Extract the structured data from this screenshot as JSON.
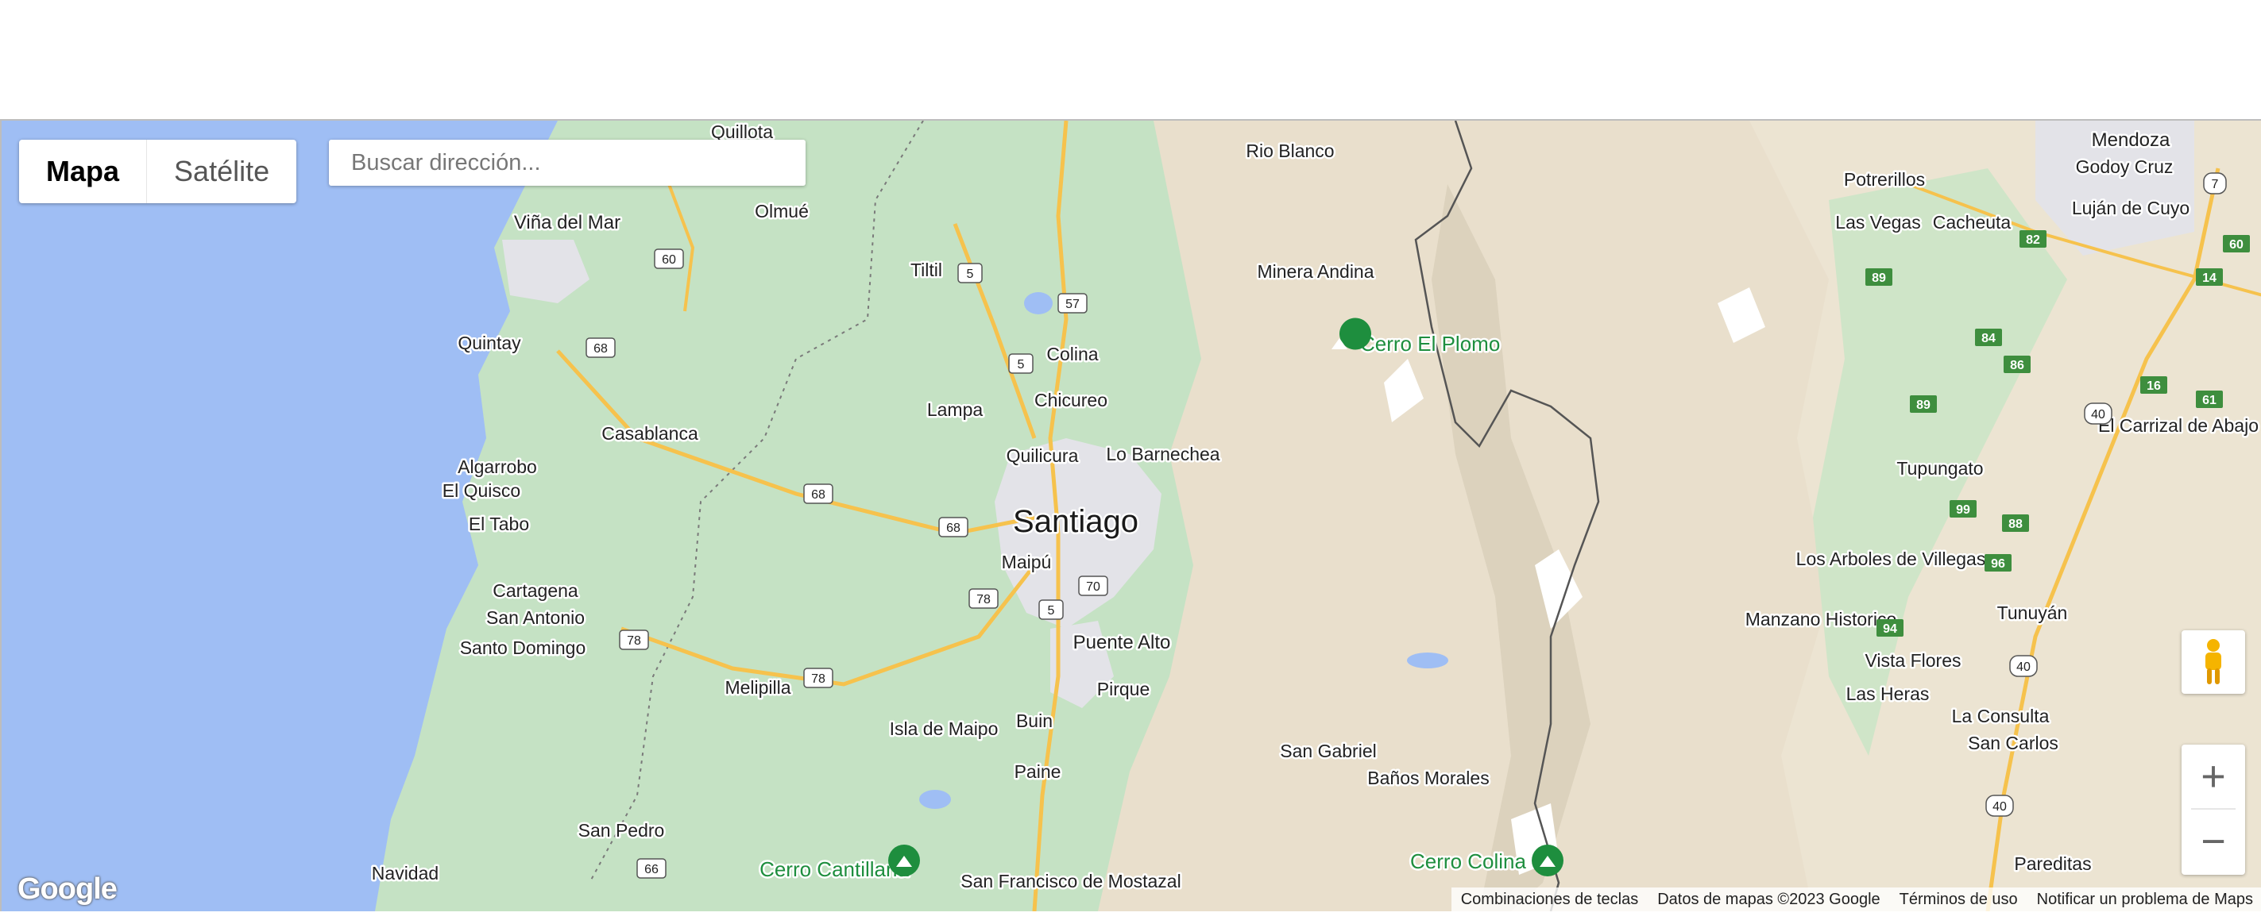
{
  "map_type": {
    "map_label": "Mapa",
    "satellite_label": "Satélite",
    "selected": "Mapa"
  },
  "search": {
    "placeholder": "Buscar dirección..."
  },
  "places": {
    "santiago": "Santiago",
    "puente_alto": "Puente Alto",
    "vina_del_mar": "Viña del Mar",
    "quillota": "Quillota",
    "olmue": "Olmué",
    "rio_blanco": "Rio Blanco",
    "mendoza": "Mendoza",
    "godoy_cruz": "Godoy Cruz",
    "potrerillos": "Potrerillos",
    "las_vegas": "Las Vegas",
    "cacheuta": "Cacheuta",
    "lujan_de_cuyo": "Luján de Cuyo",
    "tiltil": "Tiltil",
    "minera_andina": "Minera Andina",
    "quintay": "Quintay",
    "colina": "Colina",
    "cerro_el_plomo": "Cerro El Plomo",
    "chicureo": "Chicureo",
    "lampa": "Lampa",
    "casablanca": "Casablanca",
    "el_carrizal_de_abajo": "El Carrizal de Abajo",
    "algarrobo": "Algarrobo",
    "quilicura": "Quilicura",
    "lo_barnechea": "Lo Barnechea",
    "el_quisco": "El Quisco",
    "tupungato": "Tupungato",
    "el_tabo": "El Tabo",
    "maipu": "Maipú",
    "los_arboles_de_villegas": "Los Arboles de Villegas",
    "cartagena": "Cartagena",
    "san_antonio": "San Antonio",
    "tunuyan": "Tunuyán",
    "manzano_historico": "Manzano Historico",
    "santo_domingo": "Santo Domingo",
    "vista_flores": "Vista Flores",
    "melipilla": "Melipilla",
    "pirque": "Pirque",
    "las_heras": "Las Heras",
    "la_consulta": "La Consulta",
    "isla_de_maipo": "Isla de Maipo",
    "buin": "Buin",
    "san_carlos": "San Carlos",
    "san_gabriel": "San Gabriel",
    "paine": "Paine",
    "banos_morales": "Baños Morales",
    "san_pedro": "San Pedro",
    "cerro_cantillana": "Cerro Cantillana",
    "cerro_colina": "Cerro Colina",
    "pareditas": "Pareditas",
    "navidad": "Navidad",
    "san_francisco_de_mostazal": "San Francisco de Mostazal"
  },
  "route_shields": {
    "r60": "60",
    "r5a": "5",
    "r57": "57",
    "r68a": "68",
    "r5b": "5",
    "r68b": "68",
    "r68c": "68",
    "r78a": "78",
    "r70": "70",
    "r5c": "5",
    "r78b": "78",
    "r78c": "78",
    "r66": "66",
    "r7": "7",
    "r82": "82",
    "r60ar": "60",
    "r89a": "89",
    "r14": "14",
    "r84": "84",
    "r86": "86",
    "r16": "16",
    "r89b": "89",
    "r40a": "40",
    "r61": "61",
    "r99": "99",
    "r88": "88",
    "r96": "96",
    "r94": "94",
    "r40b": "40",
    "r40c": "40"
  },
  "controls": {
    "zoom_in": "+",
    "zoom_out": "−",
    "pegman": "pegman-icon"
  },
  "branding": {
    "logo": "Google"
  },
  "attribution": {
    "keyboard": "Combinaciones de teclas",
    "data": "Datos de mapas ©2023 Google",
    "terms": "Términos de uso",
    "report": "Notificar un problema de Maps"
  },
  "colors": {
    "water": "#9fbef4",
    "vegetation": "#c5e2c4",
    "mountain": "#e9dfcc",
    "highway": "#f6c24d",
    "urban": "#e3e3e8",
    "park_green": "#1e8e3e"
  }
}
